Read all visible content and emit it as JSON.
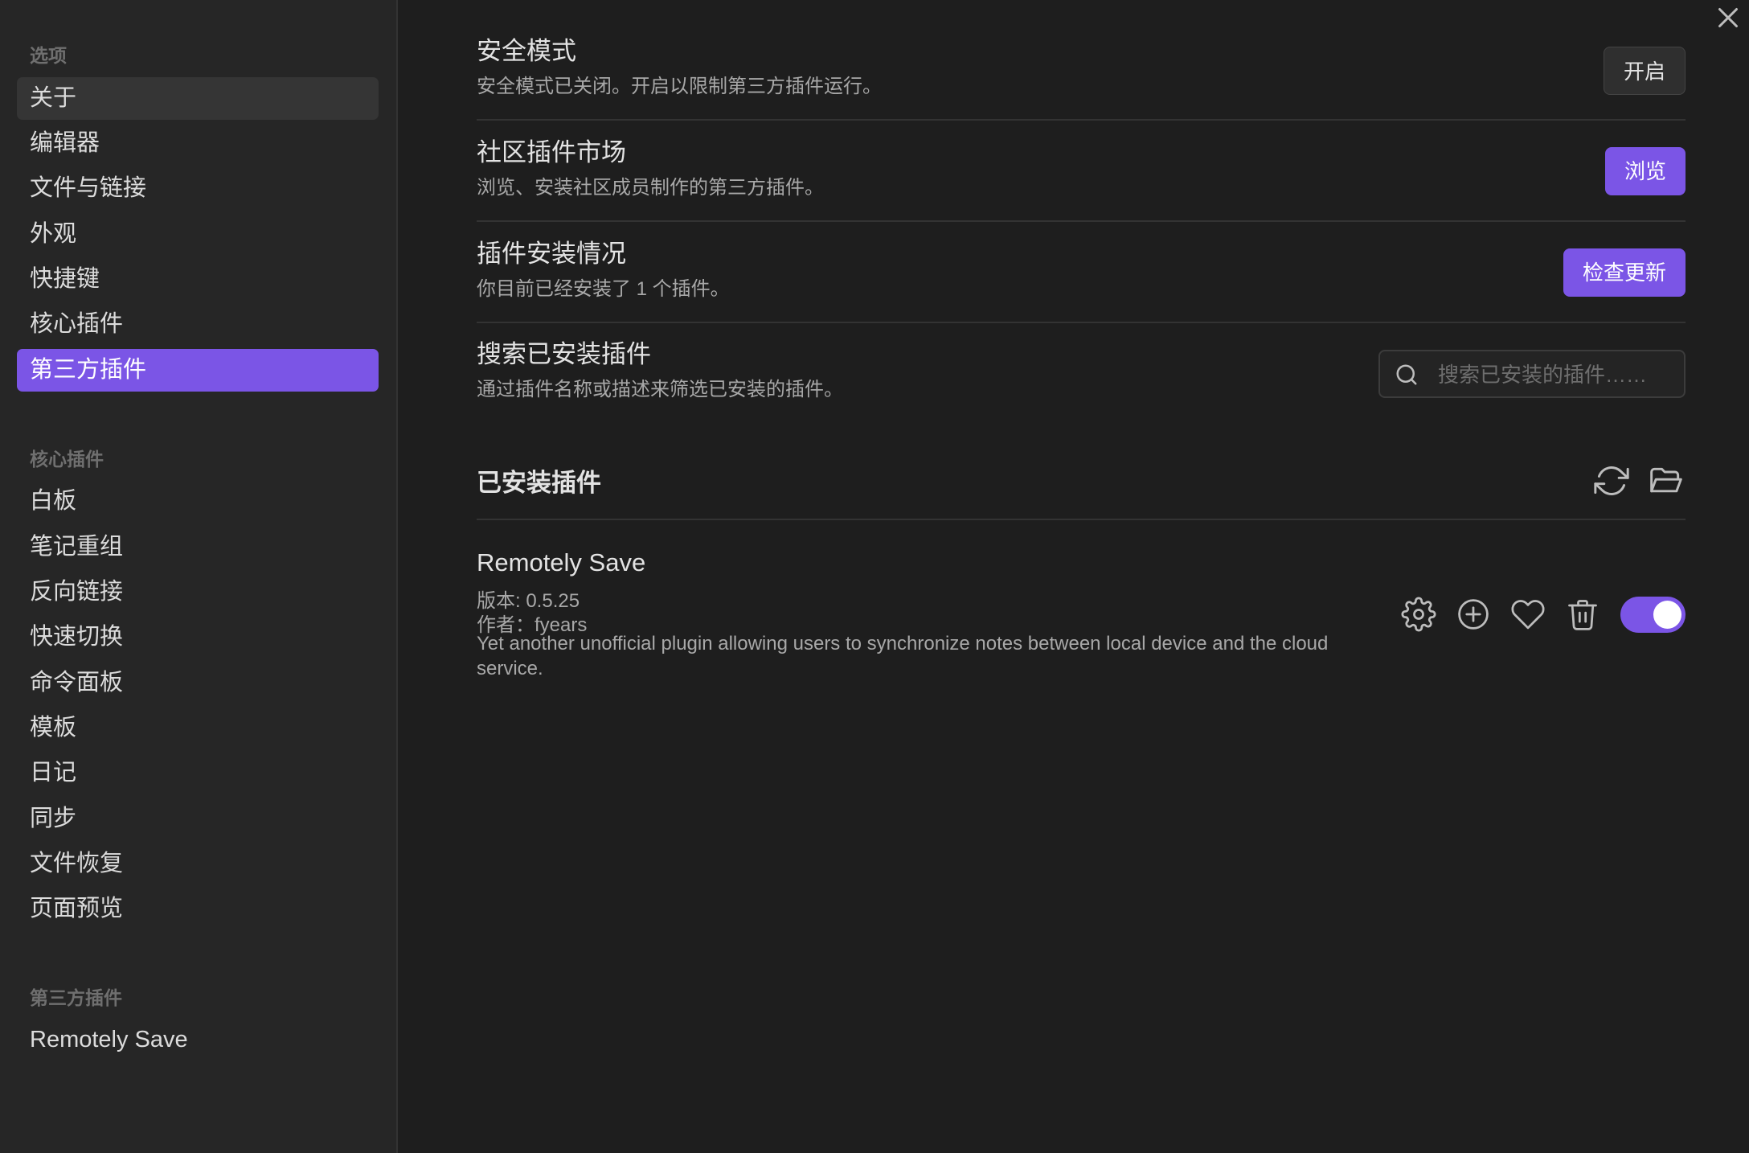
{
  "sidebar": {
    "sections": [
      {
        "heading": "选项",
        "items": [
          {
            "label": "关于"
          },
          {
            "label": "编辑器"
          },
          {
            "label": "文件与链接"
          },
          {
            "label": "外观"
          },
          {
            "label": "快捷键"
          },
          {
            "label": "核心插件"
          },
          {
            "label": "第三方插件"
          }
        ]
      },
      {
        "heading": "核心插件",
        "items": [
          {
            "label": "白板"
          },
          {
            "label": "笔记重组"
          },
          {
            "label": "反向链接"
          },
          {
            "label": "快速切换"
          },
          {
            "label": "命令面板"
          },
          {
            "label": "模板"
          },
          {
            "label": "日记"
          },
          {
            "label": "同步"
          },
          {
            "label": "文件恢复"
          },
          {
            "label": "页面预览"
          }
        ]
      },
      {
        "heading": "第三方插件",
        "items": [
          {
            "label": "Remotely Save"
          }
        ]
      }
    ]
  },
  "settings": {
    "safe_mode": {
      "title": "安全模式",
      "desc": "安全模式已关闭。开启以限制第三方插件运行。",
      "button": "开启"
    },
    "community": {
      "title": "社区插件市场",
      "desc": "浏览、安装社区成员制作的第三方插件。",
      "button": "浏览"
    },
    "status": {
      "title": "插件安装情况",
      "desc": "你目前已经安装了 1 个插件。",
      "button": "检查更新"
    },
    "search": {
      "title": "搜索已安装插件",
      "desc": "通过插件名称或描述来筛选已安装的插件。",
      "placeholder": "搜索已安装的插件……"
    }
  },
  "installed": {
    "title": "已安装插件",
    "plugins": [
      {
        "name": "Remotely Save",
        "version": "版本: 0.5.25",
        "author": "作者：fyears",
        "desc": "Yet another unofficial plugin allowing users to synchronize notes between local device and the cloud service.",
        "enabled": true
      }
    ]
  },
  "colors": {
    "accent": "#7b55e6",
    "background": "#1e1e1e",
    "sidebar": "#262626"
  }
}
